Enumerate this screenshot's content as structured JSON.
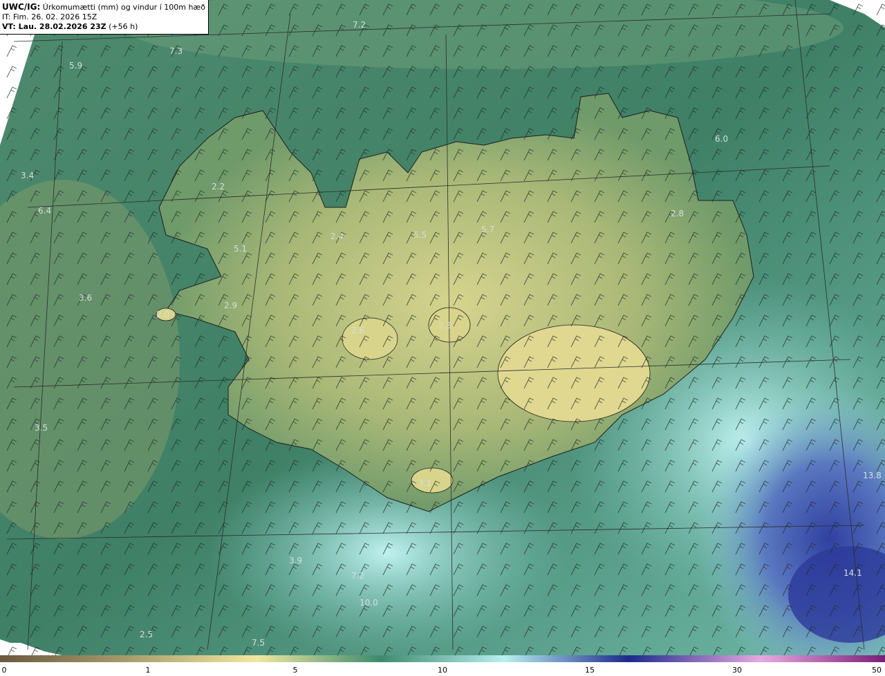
{
  "header": {
    "model": "UWC/IG:",
    "title": "Úrkomumætti (mm) og vindur í 100m hæð",
    "issue_time": "IT: Fim. 26. 02. 2026 15Z",
    "valid_prefix": "VT: Lau. 28.02.2026 23Z",
    "valid_offset": "(+56 h)"
  },
  "colorbar": {
    "labels": [
      "0",
      "1",
      "5",
      "10",
      "15",
      "30",
      "50"
    ],
    "colors": [
      "#6b5a3e",
      "#a69a6a",
      "#f0e8a0",
      "#3d8a6e",
      "#b8f0f0",
      "#1c2a8c",
      "#e8a8e0",
      "#7a1e78"
    ]
  },
  "value_labels": [
    "7.2",
    "7.3",
    "5.9",
    "3.4",
    "6.4",
    "2.2",
    "5.1",
    "2.4",
    "5.5",
    "5.7",
    "6.0",
    "2.8",
    "3.6",
    "2.0",
    "2.9",
    "2.6",
    "2.3",
    "3.5",
    "3.1",
    "13.8",
    "14.1",
    "3.9",
    "7.2",
    "10.0",
    "2.5",
    "7.5"
  ]
}
